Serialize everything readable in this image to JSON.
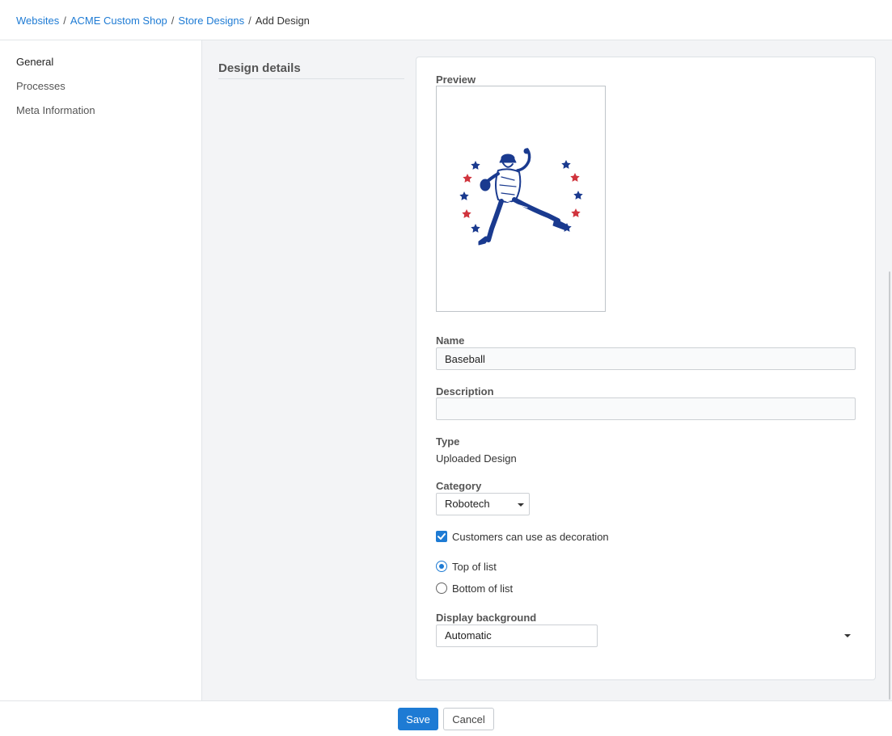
{
  "breadcrumb": {
    "items": [
      "Websites",
      "ACME Custom Shop",
      "Store Designs"
    ],
    "current": "Add Design",
    "separator": "/"
  },
  "sidebar": {
    "items": [
      {
        "label": "General",
        "active": true
      },
      {
        "label": "Processes",
        "active": false
      },
      {
        "label": "Meta Information",
        "active": false
      }
    ]
  },
  "section": {
    "title": "Design details"
  },
  "form": {
    "preview_label": "Preview",
    "preview_image": "baseball-pitcher-with-stars-logo",
    "name_label": "Name",
    "name_value": "Baseball",
    "description_label": "Description",
    "description_value": "",
    "type_label": "Type",
    "type_value": "Uploaded Design",
    "category_label": "Category",
    "category_value": "Robotech",
    "decoration_checkbox": {
      "label": "Customers can use as decoration",
      "checked": true
    },
    "position_options": [
      {
        "label": "Top of list",
        "selected": true
      },
      {
        "label": "Bottom of list",
        "selected": false
      }
    ],
    "display_background_label": "Display background",
    "display_background_value": "Automatic"
  },
  "footer": {
    "save_label": "Save",
    "cancel_label": "Cancel"
  },
  "colors": {
    "accent": "#1e7bd4",
    "star_blue": "#1a3a8f",
    "star_red": "#d0343d"
  }
}
